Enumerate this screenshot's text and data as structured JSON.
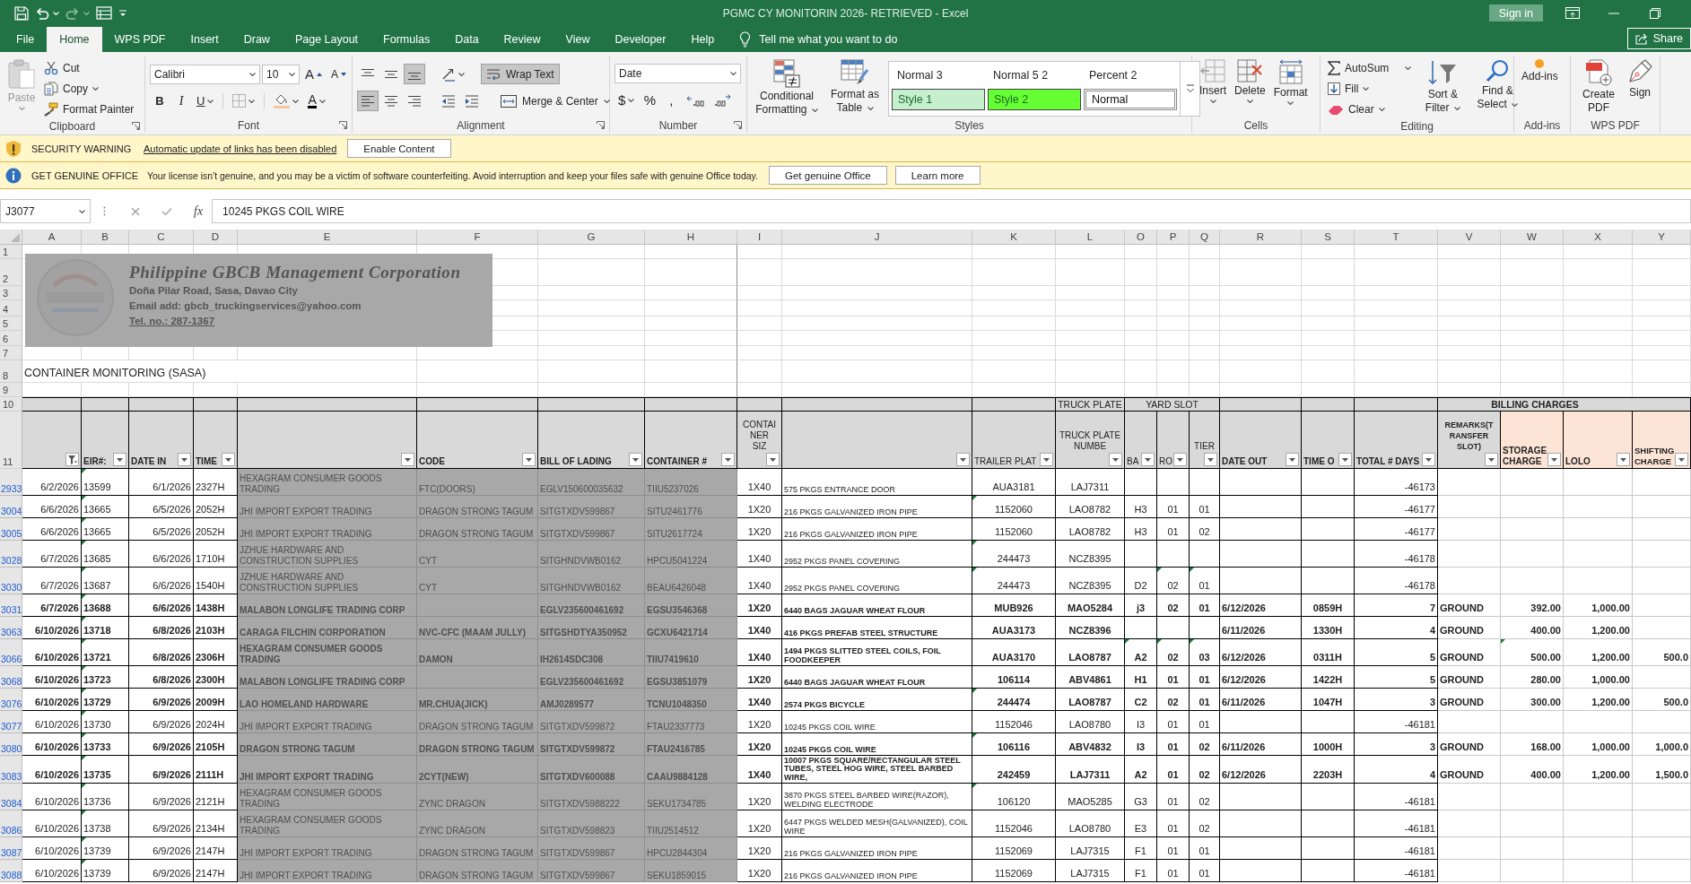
{
  "window": {
    "title": "PGMC CY MONITORIN 2026- RETRIEVED - Excel",
    "sign_in": "Sign in"
  },
  "quick_access": {
    "undo": {
      "disabled": false
    },
    "redo": {
      "disabled": true
    }
  },
  "ribbon_tabs": [
    {
      "label": "File",
      "selected": false
    },
    {
      "label": "Home",
      "selected": true
    },
    {
      "label": "WPS PDF",
      "selected": false
    },
    {
      "label": "Insert",
      "selected": false
    },
    {
      "label": "Draw",
      "selected": false
    },
    {
      "label": "Page Layout",
      "selected": false
    },
    {
      "label": "Formulas",
      "selected": false
    },
    {
      "label": "Data",
      "selected": false
    },
    {
      "label": "Review",
      "selected": false
    },
    {
      "label": "View",
      "selected": false
    },
    {
      "label": "Developer",
      "selected": false
    },
    {
      "label": "Help",
      "selected": false
    }
  ],
  "tell_me": {
    "placeholder": "Tell me what you want to do"
  },
  "share": {
    "label": "Share"
  },
  "clipboard": {
    "title": "Clipboard",
    "paste": {
      "label": "Paste",
      "disabled": true
    },
    "cut": "Cut",
    "copy": "Copy",
    "format_painter": "Format Painter"
  },
  "font": {
    "title": "Font",
    "name": "Calibri",
    "size": "10",
    "grow": "A",
    "shrink": "A",
    "bold": "B",
    "italic": "I",
    "underline": "U",
    "color_letter": "A"
  },
  "alignment": {
    "title": "Alignment",
    "vertical": [
      {
        "selected": false
      },
      {
        "selected": false
      },
      {
        "selected": true
      }
    ],
    "horizontal": [
      {
        "selected": true
      },
      {
        "selected": false
      },
      {
        "selected": false
      }
    ],
    "wrap_text": {
      "label": "Wrap Text",
      "selected": true
    },
    "merge": "Merge & Center"
  },
  "number": {
    "title": "Number",
    "format": "Date",
    "currency": "$",
    "percent": "%",
    "comma": ","
  },
  "styles": {
    "title": "Styles",
    "conditional": "Conditional Formatting",
    "format_table": "Format as Table",
    "gallery": [
      {
        "label": "Normal 3",
        "kind": "plain",
        "selected": false
      },
      {
        "label": "Normal 5 2",
        "kind": "plain",
        "selected": false
      },
      {
        "label": "Percent 2",
        "kind": "plain",
        "selected": false
      },
      {
        "label": "Style 1",
        "kind": "swatch",
        "color": "#c6efce",
        "selected": false
      },
      {
        "label": "Style 2",
        "kind": "swatch",
        "color": "#66ff33",
        "selected": false
      },
      {
        "label": "Normal",
        "kind": "swatch",
        "color": "#ffffff",
        "selected": true
      }
    ]
  },
  "cells": {
    "title": "Cells",
    "insert": "Insert",
    "delete": "Delete",
    "format": "Format"
  },
  "editing": {
    "title": "Editing",
    "autosum": "AutoSum",
    "fill": "Fill",
    "clear": "Clear",
    "sort_filter": "Sort & Filter",
    "find_select": "Find & Select"
  },
  "addins": {
    "title": "Add-ins",
    "button": "Add-ins"
  },
  "wps_pdf": {
    "title": "WPS PDF",
    "create": "Create PDF",
    "sign": "Sign"
  },
  "message_bars": [
    {
      "kind": "warning",
      "heading": "SECURITY WARNING",
      "link": "Automatic update of links has been disabled",
      "buttons": [
        "Enable Content"
      ]
    },
    {
      "kind": "info",
      "heading": "GET GENUINE OFFICE",
      "text": "Your license isn't genuine, and you may be a victim of software counterfeiting. Avoid interruption and keep your files safe with genuine Office today.",
      "buttons": [
        "Get genuine Office",
        "Learn more"
      ]
    }
  ],
  "formula_bar": {
    "name_box": "J3077",
    "fx": "fx",
    "value": "10245 PKGS COIL WIRE"
  },
  "sheet": {
    "letterhead": {
      "company": "Philippine GBCB Management Corporation",
      "address": "Doña Pilar Road, Sasa, Davao City",
      "email": "Email add: gbcb_truckingservices@yahoo.com",
      "phone": "Tel. no.: 287-1367"
    },
    "title": "CONTAINER MONITORING (SASA)",
    "row_numbers": [
      "1",
      "2",
      "3",
      "4",
      "5",
      "6",
      "7",
      "8",
      "9",
      "10",
      "11"
    ],
    "group_headers": [
      {
        "label": "TRUCK PLATE",
        "bold": false
      },
      {
        "label": "YARD SLOT",
        "bold": false
      },
      {
        "label": "BILLING CHARGES",
        "bold": true
      }
    ],
    "columns": [
      {
        "letter": "A",
        "filtered": true,
        "kind": "standard",
        "greyed": false
      },
      {
        "letter": "B",
        "heading": "EIR#:",
        "bold": true,
        "filtered": false,
        "kind": "standard",
        "greyed": false
      },
      {
        "letter": "C",
        "heading": "DATE IN",
        "bold": true,
        "filtered": false,
        "kind": "standard",
        "greyed": false
      },
      {
        "letter": "D",
        "heading": "TIME",
        "bold": true,
        "filtered": false,
        "kind": "standard",
        "greyed": false
      },
      {
        "letter": "E",
        "filtered": false,
        "kind": "standard",
        "greyed": true
      },
      {
        "letter": "F",
        "heading": "CODE",
        "bold": true,
        "filtered": false,
        "kind": "standard",
        "greyed": true
      },
      {
        "letter": "G",
        "heading": "BILL OF LADING",
        "bold": true,
        "filtered": false,
        "kind": "standard",
        "greyed": true
      },
      {
        "letter": "H",
        "heading": "CONTAINER #",
        "bold": true,
        "filtered": false,
        "kind": "standard",
        "greyed": true
      },
      {
        "letter": "I",
        "heading": "CONTAINER SIZ",
        "bold": false,
        "filtered": false,
        "kind": "standard",
        "greyed": false
      },
      {
        "letter": "J",
        "filtered": false,
        "kind": "standard",
        "greyed": false
      },
      {
        "letter": "K",
        "heading": "TRAILER PLAT",
        "bold": false,
        "filtered": false,
        "kind": "standard",
        "greyed": false
      },
      {
        "letter": "L",
        "heading": "TRUCK PLATE NUMBE",
        "bold": false,
        "filtered": false,
        "kind": "standard",
        "greyed": false
      },
      {
        "letter": "O",
        "heading": "BA",
        "bold": false,
        "filtered": false,
        "kind": "standard",
        "greyed": false
      },
      {
        "letter": "P",
        "heading": "RO",
        "bold": false,
        "filtered": false,
        "kind": "standard",
        "greyed": false
      },
      {
        "letter": "Q",
        "heading": "TIER",
        "bold": false,
        "filtered": false,
        "kind": "standard",
        "greyed": false
      },
      {
        "letter": "R",
        "heading": "DATE OUT",
        "bold": true,
        "filtered": false,
        "kind": "standard",
        "greyed": false
      },
      {
        "letter": "S",
        "heading": "TIME O",
        "bold": true,
        "filtered": false,
        "kind": "standard",
        "greyed": false
      },
      {
        "letter": "T",
        "heading": "TOTAL # DAYS",
        "bold": true,
        "filtered": false,
        "kind": "standard",
        "greyed": false
      },
      {
        "letter": "V",
        "heading": "REMARKS(TRANSFER SLOT)",
        "bold": true,
        "filtered": false,
        "kind": "standard",
        "greyed": false
      },
      {
        "letter": "W",
        "heading": "STORAGE CHARGE",
        "bold": true,
        "filtered": false,
        "kind": "charge",
        "greyed": false
      },
      {
        "letter": "X",
        "heading": "LOLO",
        "bold": true,
        "filtered": false,
        "kind": "charge",
        "greyed": false
      },
      {
        "letter": "Y",
        "heading": "SHIFTING CHARGE",
        "bold": true,
        "filtered": false,
        "kind": "charge",
        "greyed": false
      }
    ],
    "rows": [
      {
        "number": "2933",
        "bold": false,
        "flags": {
          "eir": true
        },
        "cells": {
          "column_1": "6/2/2026",
          "eir": "13599",
          "date_in": "6/1/2026",
          "time": "2327H",
          "column_5": "HEXAGRAM CONSUMER GOODS TRADING",
          "code": "FTC(DOORS)",
          "bill_of_lading": "EGLV150600035632",
          "container": "TIIU5237026",
          "column_9": "1X40",
          "column_10": "575 PKGS ENTRANCE DOOR",
          "column_11": "AUA3181",
          "column_12": "LAJ7311",
          "total_days": "-46173"
        }
      },
      {
        "number": "3004",
        "bold": false,
        "flags": {
          "eir": true,
          "column_11": true
        },
        "cells": {
          "column_1": "6/6/2026",
          "eir": "13665",
          "date_in": "6/5/2026",
          "time": "2052H",
          "column_5": "JHI IMPORT EXPORT TRADING",
          "code": "DRAGON STRONG TAGUM",
          "bill_of_lading": "SITGTXDV599867",
          "container": "SITU2461776",
          "column_9": "1X20",
          "column_10": "216 PKGS GALVANIZED IRON PIPE",
          "column_11": "1152060",
          "column_12": "LAO8782",
          "column_13": "H3",
          "column_14": "01",
          "tier": "01",
          "total_days": "-46177"
        }
      },
      {
        "number": "3005",
        "bold": false,
        "flags": {
          "eir": true
        },
        "cells": {
          "column_1": "6/6/2026",
          "eir": "13665",
          "date_in": "6/5/2026",
          "time": "2052H",
          "column_5": "JHI IMPORT EXPORT TRADING",
          "code": "DRAGON STRONG TAGUM",
          "bill_of_lading": "SITGTXDV599867",
          "container": "SITU2617724",
          "column_9": "1X20",
          "column_10": "216 PKGS GALVANIZED IRON PIPE",
          "column_11": "1152060",
          "column_12": "LAO8782",
          "column_13": "H3",
          "column_14": "01",
          "tier": "02",
          "total_days": "-46177"
        }
      },
      {
        "number": "3028",
        "bold": false,
        "flags": {
          "eir": true,
          "column_11": true
        },
        "cells": {
          "column_1": "6/7/2026",
          "eir": "13685",
          "date_in": "6/6/2026",
          "time": "1710H",
          "column_5": "JZHUE HARDWARE AND CONSTRUCTION SUPPLIES",
          "code": "CYT",
          "bill_of_lading": "SITGHNDVWB0162",
          "container": "HPCU5041224",
          "column_9": "1X40",
          "column_10": "2952 PKGS PANEL COVERING",
          "column_11": "244473",
          "column_12": "NCZ8395",
          "total_days": "-46178"
        }
      },
      {
        "number": "3030",
        "bold": false,
        "flags": {
          "eir": true,
          "column_11": true,
          "column_14": true,
          "tier": true
        },
        "cells": {
          "column_1": "6/7/2026",
          "eir": "13687",
          "date_in": "6/6/2026",
          "time": "1540H",
          "column_5": "JZHUE HARDWARE AND CONSTRUCTION SUPPLIES",
          "code": "CYT",
          "bill_of_lading": "SITGHNDVWB0162",
          "container": "BEAU6426048",
          "column_9": "1X40",
          "column_10": "2952 PKGS PANEL COVERING",
          "column_11": "244473",
          "column_12": "NCZ8395",
          "column_13": "D2",
          "column_14": "02",
          "tier": "01",
          "total_days": "-46178"
        }
      },
      {
        "number": "3031",
        "bold": true,
        "flags": {
          "eir": true
        },
        "cells": {
          "column_1": "6/7/2026",
          "eir": "13688",
          "date_in": "6/6/2026",
          "time": "1438H",
          "column_5": "MALABON LONGLIFE TRADING CORP",
          "bill_of_lading": "EGLV235600461692",
          "container": "EGSU3546368",
          "column_9": "1X20",
          "column_10": "6440 BAGS JAGUAR WHEAT FLOUR",
          "column_11": "MUB926",
          "column_12": "MAO5284",
          "column_13": "j3",
          "column_14": "02",
          "tier": "01",
          "date_out": "6/12/2026",
          "column_17": "0859H",
          "total_days": "7",
          "remarks": "GROUND",
          "storage_charge": "392.00",
          "lolo": "1,000.00"
        }
      },
      {
        "number": "3063",
        "bold": true,
        "flags": {
          "eir": true
        },
        "cells": {
          "column_1": "6/10/2026",
          "eir": "13718",
          "date_in": "6/8/2026",
          "time": "2103H",
          "column_5": "CARAGA FILCHIN CORPORATION",
          "code": "NVC-CFC (MAAM JULLY)",
          "bill_of_lading": "SITGSHDTYA350952",
          "container": "GCXU6421714",
          "column_9": "1X40",
          "column_10": "416 PKGS PREFAB STEEL STRUCTURE",
          "column_11": "AUA3173",
          "column_12": "NCZ8396",
          "date_out": "6/11/2026",
          "column_17": "1330H",
          "total_days": "4",
          "remarks": "GROUND",
          "storage_charge": "400.00",
          "lolo": "1,200.00"
        }
      },
      {
        "number": "3066",
        "bold": true,
        "flags": {
          "eir": true,
          "column_13": true,
          "column_14": true,
          "tier": true,
          "storage_charge": true
        },
        "cells": {
          "column_1": "6/10/2026",
          "eir": "13721",
          "date_in": "6/8/2026",
          "time": "2306H",
          "column_5": "HEXAGRAM CONSUMER GOODS TRADING",
          "code": "DAMON",
          "bill_of_lading": "IH2614SDC308",
          "container": "TIIU7419610",
          "column_9": "1X40",
          "column_10": "1494 PKGS SLITTED STEEL COILS, FOIL FOODKEEPER",
          "column_11": "AUA3170",
          "column_12": "LAO8787",
          "column_13": "A2",
          "column_14": "02",
          "tier": "03",
          "date_out": "6/12/2026",
          "column_17": "0311H",
          "total_days": "5",
          "remarks": "GROUND",
          "storage_charge": "500.00",
          "lolo": "1,200.00",
          "shifting_charge": "500.0"
        }
      },
      {
        "number": "3068",
        "bold": true,
        "flags": {
          "eir": true
        },
        "cells": {
          "column_1": "6/10/2026",
          "eir": "13723",
          "date_in": "6/8/2026",
          "time": "2300H",
          "column_5": "MALABON LONGLIFE TRADING CORP",
          "bill_of_lading": "EGLV235600461692",
          "container": "EGSU3851079",
          "column_9": "1X20",
          "column_10": "6440 BAGS JAGUAR WHEAT FLOUR",
          "column_11": "106114",
          "column_12": "ABV4861",
          "column_13": "H1",
          "column_14": "01",
          "tier": "01",
          "date_out": "6/12/2026",
          "column_17": "1422H",
          "total_days": "5",
          "remarks": "GROUND",
          "storage_charge": "280.00",
          "lolo": "1,000.00"
        }
      },
      {
        "number": "3076",
        "bold": true,
        "flags": {
          "eir": true,
          "column_11": true
        },
        "cells": {
          "column_1": "6/10/2026",
          "eir": "13729",
          "date_in": "6/9/2026",
          "time": "2009H",
          "column_5": "LAO HOMELAND HARDWARE",
          "code": "MR.CHUA(JICK)",
          "bill_of_lading": "AMJ0289577",
          "container": "TCNU1048350",
          "column_9": "1X40",
          "column_10": "2574 PKGS BICYCLE",
          "column_11": "244474",
          "column_12": "LAO8787",
          "column_13": "C2",
          "column_14": "02",
          "tier": "01",
          "date_out": "6/11/2026",
          "column_17": "1047H",
          "total_days": "3",
          "remarks": "GROUND",
          "storage_charge": "300.00",
          "lolo": "1,200.00",
          "shifting_charge": "500.0"
        }
      },
      {
        "number": "3077",
        "bold": false,
        "flags": {
          "eir": true
        },
        "cells": {
          "column_1": "6/10/2026",
          "eir": "13730",
          "date_in": "6/9/2026",
          "time": "2024H",
          "column_5": "JHI IMPORT EXPORT TRADING",
          "code": "DRAGON STRONG TAGUM",
          "bill_of_lading": "SITGTXDV599872",
          "container": "FTAU2337773",
          "column_9": "1X20",
          "column_10": "10245 PKGS COIL WIRE",
          "column_11": "1152046",
          "column_12": "LAO8780",
          "column_13": "I3",
          "column_14": "01",
          "tier": "01",
          "total_days": "-46181"
        }
      },
      {
        "number": "3080",
        "bold": true,
        "flags": {
          "eir": true,
          "column_11": true
        },
        "cells": {
          "column_1": "6/10/2026",
          "eir": "13733",
          "date_in": "6/9/2026",
          "time": "2105H",
          "column_5": "DRAGON STRONG TAGUM",
          "code": "DRAGON STRONG TAGUM",
          "bill_of_lading": "SITGTXDV599872",
          "container": "FTAU2416785",
          "column_9": "1X20",
          "column_10": "10245 PKGS COIL WIRE",
          "column_11": "106116",
          "column_12": "ABV4832",
          "column_13": "I3",
          "column_14": "01",
          "tier": "02",
          "date_out": "6/11/2026",
          "column_17": "1000H",
          "total_days": "3",
          "remarks": "GROUND",
          "storage_charge": "168.00",
          "lolo": "1,000.00",
          "shifting_charge": "1,000.0"
        }
      },
      {
        "number": "3083",
        "bold": true,
        "flags": {
          "eir": true
        },
        "cells": {
          "column_1": "6/10/2026",
          "eir": "13735",
          "date_in": "6/9/2026",
          "time": "2111H",
          "column_5": "JHI IMPORT EXPORT TRADING",
          "code": "2CYT(NEW)",
          "bill_of_lading": "SITGTXDV600088",
          "container": "CAAU9884128",
          "column_9": "1X40",
          "column_10": "10007 PKGS SQUARE/RECTANGULAR STEEL TUBES, STEEL HOG WIRE, STEEL BARBED WIRE,",
          "column_11": "242459",
          "column_12": "LAJ7311",
          "column_13": "A2",
          "column_14": "01",
          "tier": "02",
          "date_out": "6/12/2026",
          "column_17": "2203H",
          "total_days": "4",
          "remarks": "GROUND",
          "storage_charge": "400.00",
          "lolo": "1,200.00",
          "shifting_charge": "1,500.0"
        }
      },
      {
        "number": "3084",
        "bold": false,
        "flags": {
          "eir": true,
          "column_11": true
        },
        "cells": {
          "column_1": "6/10/2026",
          "eir": "13736",
          "date_in": "6/9/2026",
          "time": "2121H",
          "column_5": "HEXAGRAM CONSUMER GOODS TRADING",
          "code": "ZYNC DRAGON",
          "bill_of_lading": "SITGTXDV5988222",
          "container": "SEKU1734785",
          "column_9": "1X20",
          "column_10": "3870 PKGS STEEL BARBED WIRE(RAZOR), WELDING ELECTRODE",
          "column_11": "106120",
          "column_12": "MAO5285",
          "column_13": "G3",
          "column_14": "01",
          "tier": "02",
          "total_days": "-46181"
        }
      },
      {
        "number": "3086",
        "bold": false,
        "flags": {
          "eir": true
        },
        "cells": {
          "column_1": "6/10/2026",
          "eir": "13738",
          "date_in": "6/9/2026",
          "time": "2134H",
          "column_5": "HEXAGRAM CONSUMER GOODS TRADING",
          "code": "ZYNC DRAGON",
          "bill_of_lading": "SITGTXDV598823",
          "container": "TIIU2514512",
          "column_9": "1X20",
          "column_10": "6447 PKGS WELDED MESH(GALVANIZED), COIL WIRE",
          "column_11": "1152046",
          "column_12": "LAO8780",
          "column_13": "E3",
          "column_14": "01",
          "tier": "02",
          "total_days": "-46181"
        }
      },
      {
        "number": "3087",
        "bold": false,
        "flags": {
          "eir": true
        },
        "cells": {
          "column_1": "6/10/2026",
          "eir": "13739",
          "date_in": "6/9/2026",
          "time": "2147H",
          "column_5": "JHI IMPORT EXPORT TRADING",
          "code": "DRAGON STRONG TAGUM",
          "bill_of_lading": "SITGTXDV599867",
          "container": "HPCU2844304",
          "column_9": "1X20",
          "column_10": "216 PKGS GALVANIZED IRON PIPE",
          "column_11": "1152069",
          "column_12": "LAJ7315",
          "column_13": "F1",
          "column_14": "01",
          "tier": "01",
          "total_days": "-46181"
        }
      },
      {
        "number": "3088",
        "bold": false,
        "flags": {
          "eir": true
        },
        "cells": {
          "column_1": "6/10/2026",
          "eir": "13739",
          "date_in": "6/9/2026",
          "time": "2147H",
          "column_5": "JHI IMPORT EXPORT TRADING",
          "code": "DRAGON STRONG TAGUM",
          "bill_of_lading": "SITGTXDV599867",
          "container": "SEKU1859015",
          "column_9": "1X20",
          "column_10": "216 PKGS GALVANIZED IRON PIPE",
          "column_11": "1152069",
          "column_12": "LAJ7315",
          "column_13": "F1",
          "column_14": "01",
          "tier": "01",
          "total_days": "-46181"
        }
      }
    ]
  }
}
